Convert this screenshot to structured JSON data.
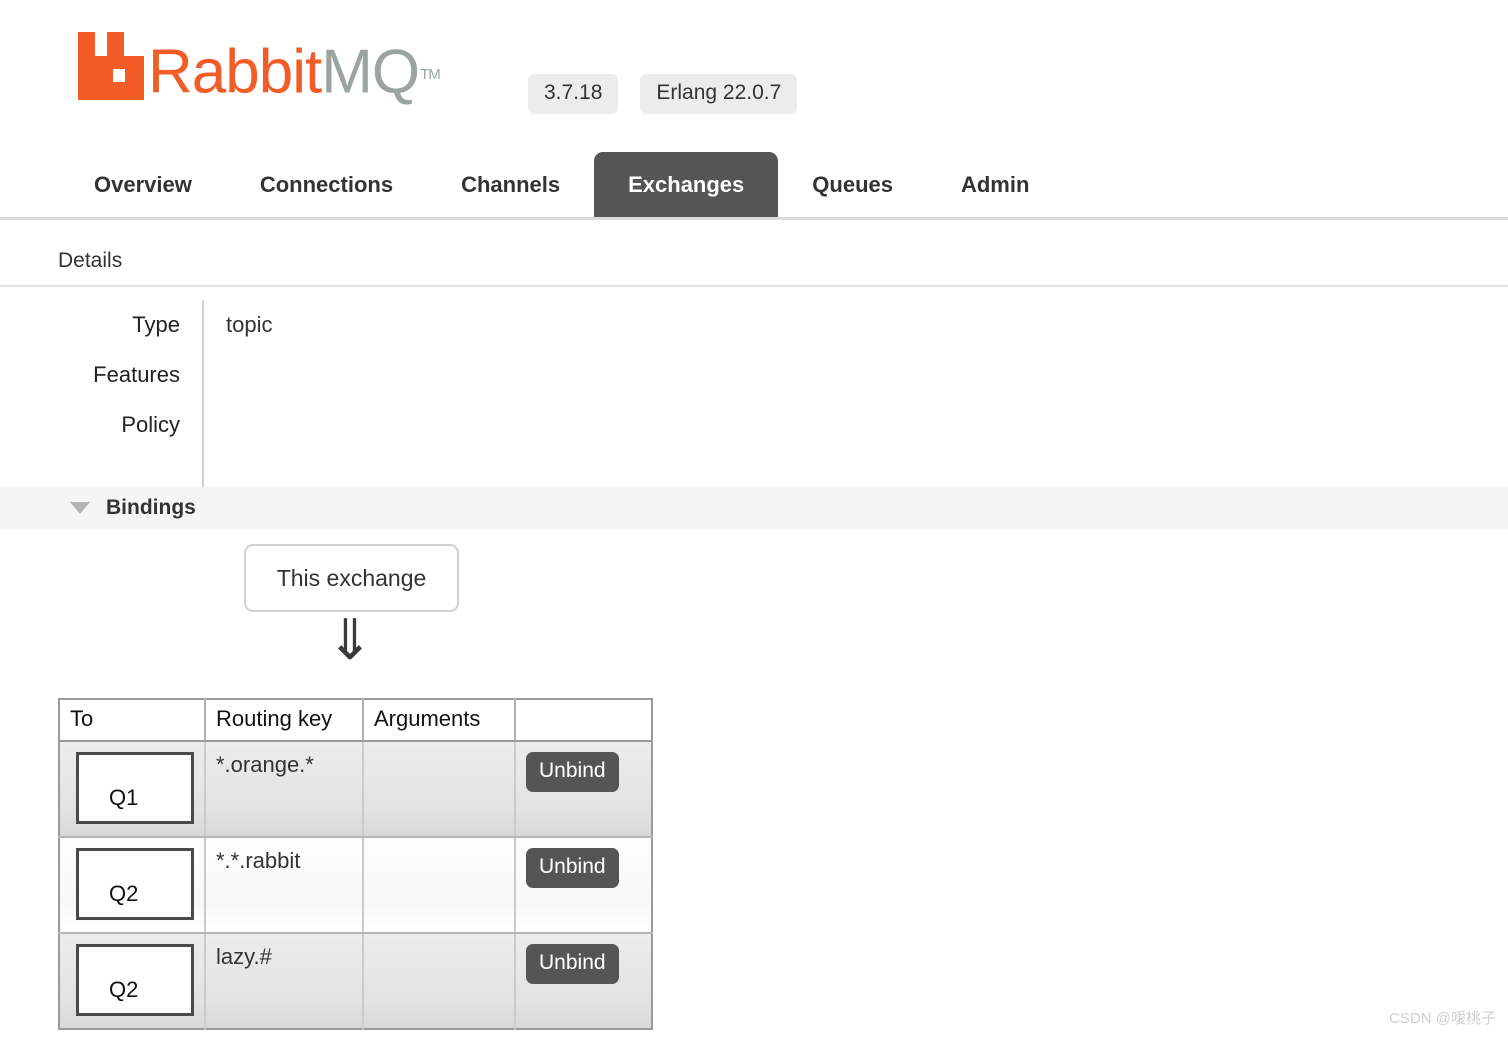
{
  "header": {
    "logo_rabbit": "Rabbit",
    "logo_mq": "MQ",
    "logo_tm": "TM",
    "version_badge": "3.7.18",
    "erlang_badge": "Erlang 22.0.7",
    "brand_color": "#F25C26",
    "mq_color": "#9AA5A0"
  },
  "nav": {
    "tabs": [
      {
        "label": "Overview",
        "active": false
      },
      {
        "label": "Connections",
        "active": false
      },
      {
        "label": "Channels",
        "active": false
      },
      {
        "label": "Exchanges",
        "active": true
      },
      {
        "label": "Queues",
        "active": false
      },
      {
        "label": "Admin",
        "active": false
      }
    ],
    "active_tab_color": "#555555"
  },
  "details": {
    "heading": "Details",
    "rows": [
      {
        "label": "Type",
        "value": "topic"
      },
      {
        "label": "Features",
        "value": ""
      },
      {
        "label": "Policy",
        "value": ""
      }
    ]
  },
  "bindings": {
    "heading": "Bindings",
    "caret_icon": "triangle-down-icon",
    "source_box_label": "This exchange",
    "arrow_glyph": "⇓",
    "table": {
      "columns": [
        "To",
        "Routing key",
        "Arguments",
        ""
      ],
      "rows": [
        {
          "to": "Q1",
          "routing_key": "*.orange.*",
          "arguments": "",
          "action": "Unbind",
          "shade": "row-shade"
        },
        {
          "to": "Q2",
          "routing_key": "*.*.rabbit",
          "arguments": "",
          "action": "Unbind",
          "shade": "row-light"
        },
        {
          "to": "Q2",
          "routing_key": "lazy.#",
          "arguments": "",
          "action": "Unbind",
          "shade": "row-shade"
        }
      ]
    }
  },
  "watermark": "CSDN @噯桃子"
}
